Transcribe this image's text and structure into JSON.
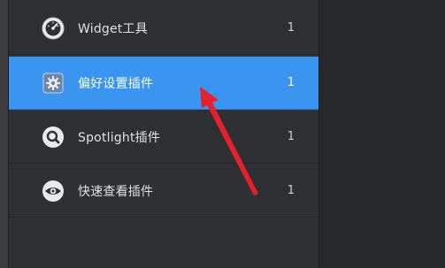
{
  "plugins": [
    {
      "label": "Widget工具",
      "count": "1",
      "icon": "dashboard-icon",
      "selected": false
    },
    {
      "label": "偏好设置插件",
      "count": "1",
      "icon": "gear-icon",
      "selected": true
    },
    {
      "label": "Spotlight插件",
      "count": "1",
      "icon": "magnifier-icon",
      "selected": false
    },
    {
      "label": "快速查看插件",
      "count": "1",
      "icon": "eye-icon",
      "selected": false
    }
  ],
  "colors": {
    "selected_row": "#3a95f0",
    "sidebar_bg": "#2e3034",
    "annotation_arrow": "#e8202a"
  }
}
